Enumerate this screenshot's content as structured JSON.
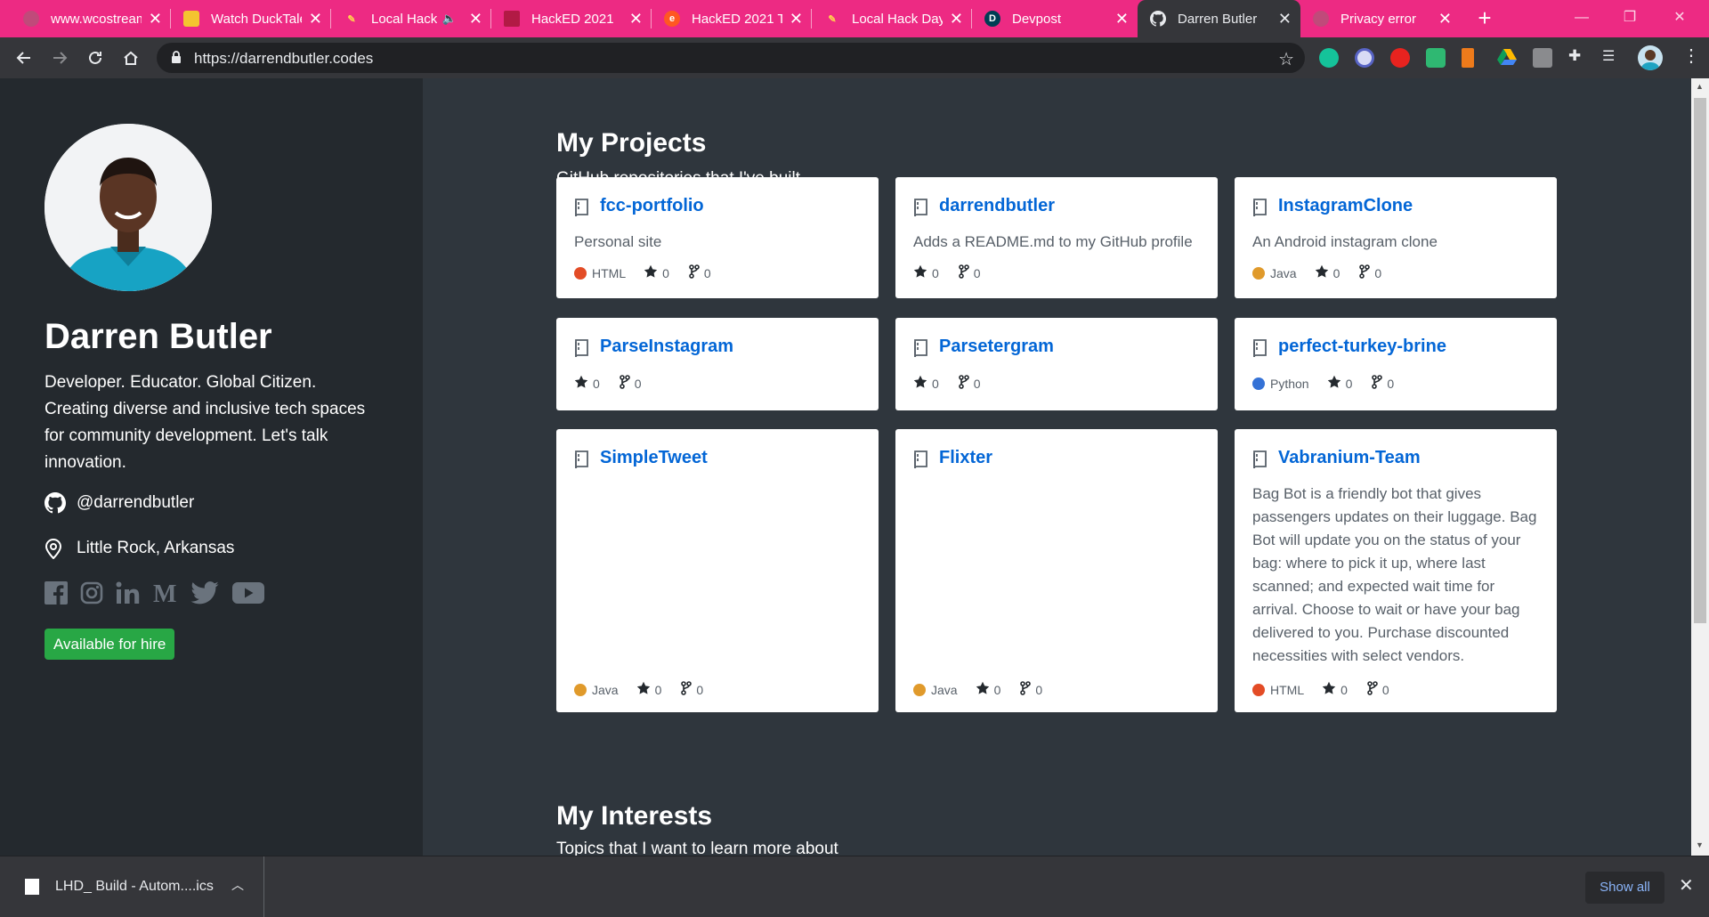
{
  "browser": {
    "tabs": [
      {
        "title": "www.wcostream",
        "active": false
      },
      {
        "title": "Watch DuckTales",
        "active": false
      },
      {
        "title": "Local Hack",
        "active": false
      },
      {
        "title": "HackED 2021",
        "active": false
      },
      {
        "title": "HackED 2021 T",
        "active": false
      },
      {
        "title": "Local Hack Day",
        "active": false
      },
      {
        "title": "Devpost",
        "active": false
      },
      {
        "title": "Darren Butler",
        "active": true
      },
      {
        "title": "Privacy error",
        "active": false
      }
    ],
    "url": "https://darrendbutler.codes",
    "accent_color": "#ed2a83"
  },
  "profile": {
    "name": "Darren Butler",
    "bio": "Developer. Educator. Global Citizen. Creating diverse and inclusive tech spaces for community development. Let's talk innovation.",
    "github_handle": "@darrendbutler",
    "location": "Little Rock, Arkansas",
    "socials": [
      "facebook-icon",
      "instagram-icon",
      "linkedin-icon",
      "medium-icon",
      "twitter-icon",
      "youtube-icon"
    ],
    "hire_label": "Available for hire"
  },
  "projects": {
    "title": "My Projects",
    "subtitle": "GitHub repositories that I've built.",
    "repos": [
      {
        "name": "fcc-portfolio",
        "description": "Personal site",
        "language": "HTML",
        "language_color": "#e34c26",
        "stars": "0",
        "forks": "0"
      },
      {
        "name": "darrendbutler",
        "description": "Adds a README.md to my GitHub profile",
        "language": "",
        "language_color": "",
        "stars": "0",
        "forks": "0"
      },
      {
        "name": "InstagramClone",
        "description": "An Android instagram clone",
        "language": "Java",
        "language_color": "#e09a2b",
        "stars": "0",
        "forks": "0"
      },
      {
        "name": "ParseInstagram",
        "description": "",
        "language": "",
        "language_color": "",
        "stars": "0",
        "forks": "0"
      },
      {
        "name": "Parsetergram",
        "description": "",
        "language": "",
        "language_color": "",
        "stars": "0",
        "forks": "0"
      },
      {
        "name": "perfect-turkey-brine",
        "description": "",
        "language": "Python",
        "language_color": "#3572d6",
        "stars": "0",
        "forks": "0"
      },
      {
        "name": "SimpleTweet",
        "description": "",
        "language": "Java",
        "language_color": "#e09a2b",
        "stars": "0",
        "forks": "0"
      },
      {
        "name": "Flixter",
        "description": "",
        "language": "Java",
        "language_color": "#e09a2b",
        "stars": "0",
        "forks": "0"
      },
      {
        "name": "Vabranium-Team",
        "description": "Bag Bot is a friendly bot that gives passengers updates on their luggage. Bag Bot will update you on the status of your bag: where to pick it up, where last scanned; and expected wait time for arrival. Choose to wait or have your bag delivered to you. Purchase discounted necessities with select vendors.",
        "language": "HTML",
        "language_color": "#e34c26",
        "stars": "0",
        "forks": "0"
      }
    ]
  },
  "interests": {
    "title": "My Interests",
    "subtitle": "Topics that I want to learn more about"
  },
  "downloads": {
    "file_name": "LHD_ Build - Autom....ics",
    "show_all_label": "Show all"
  }
}
